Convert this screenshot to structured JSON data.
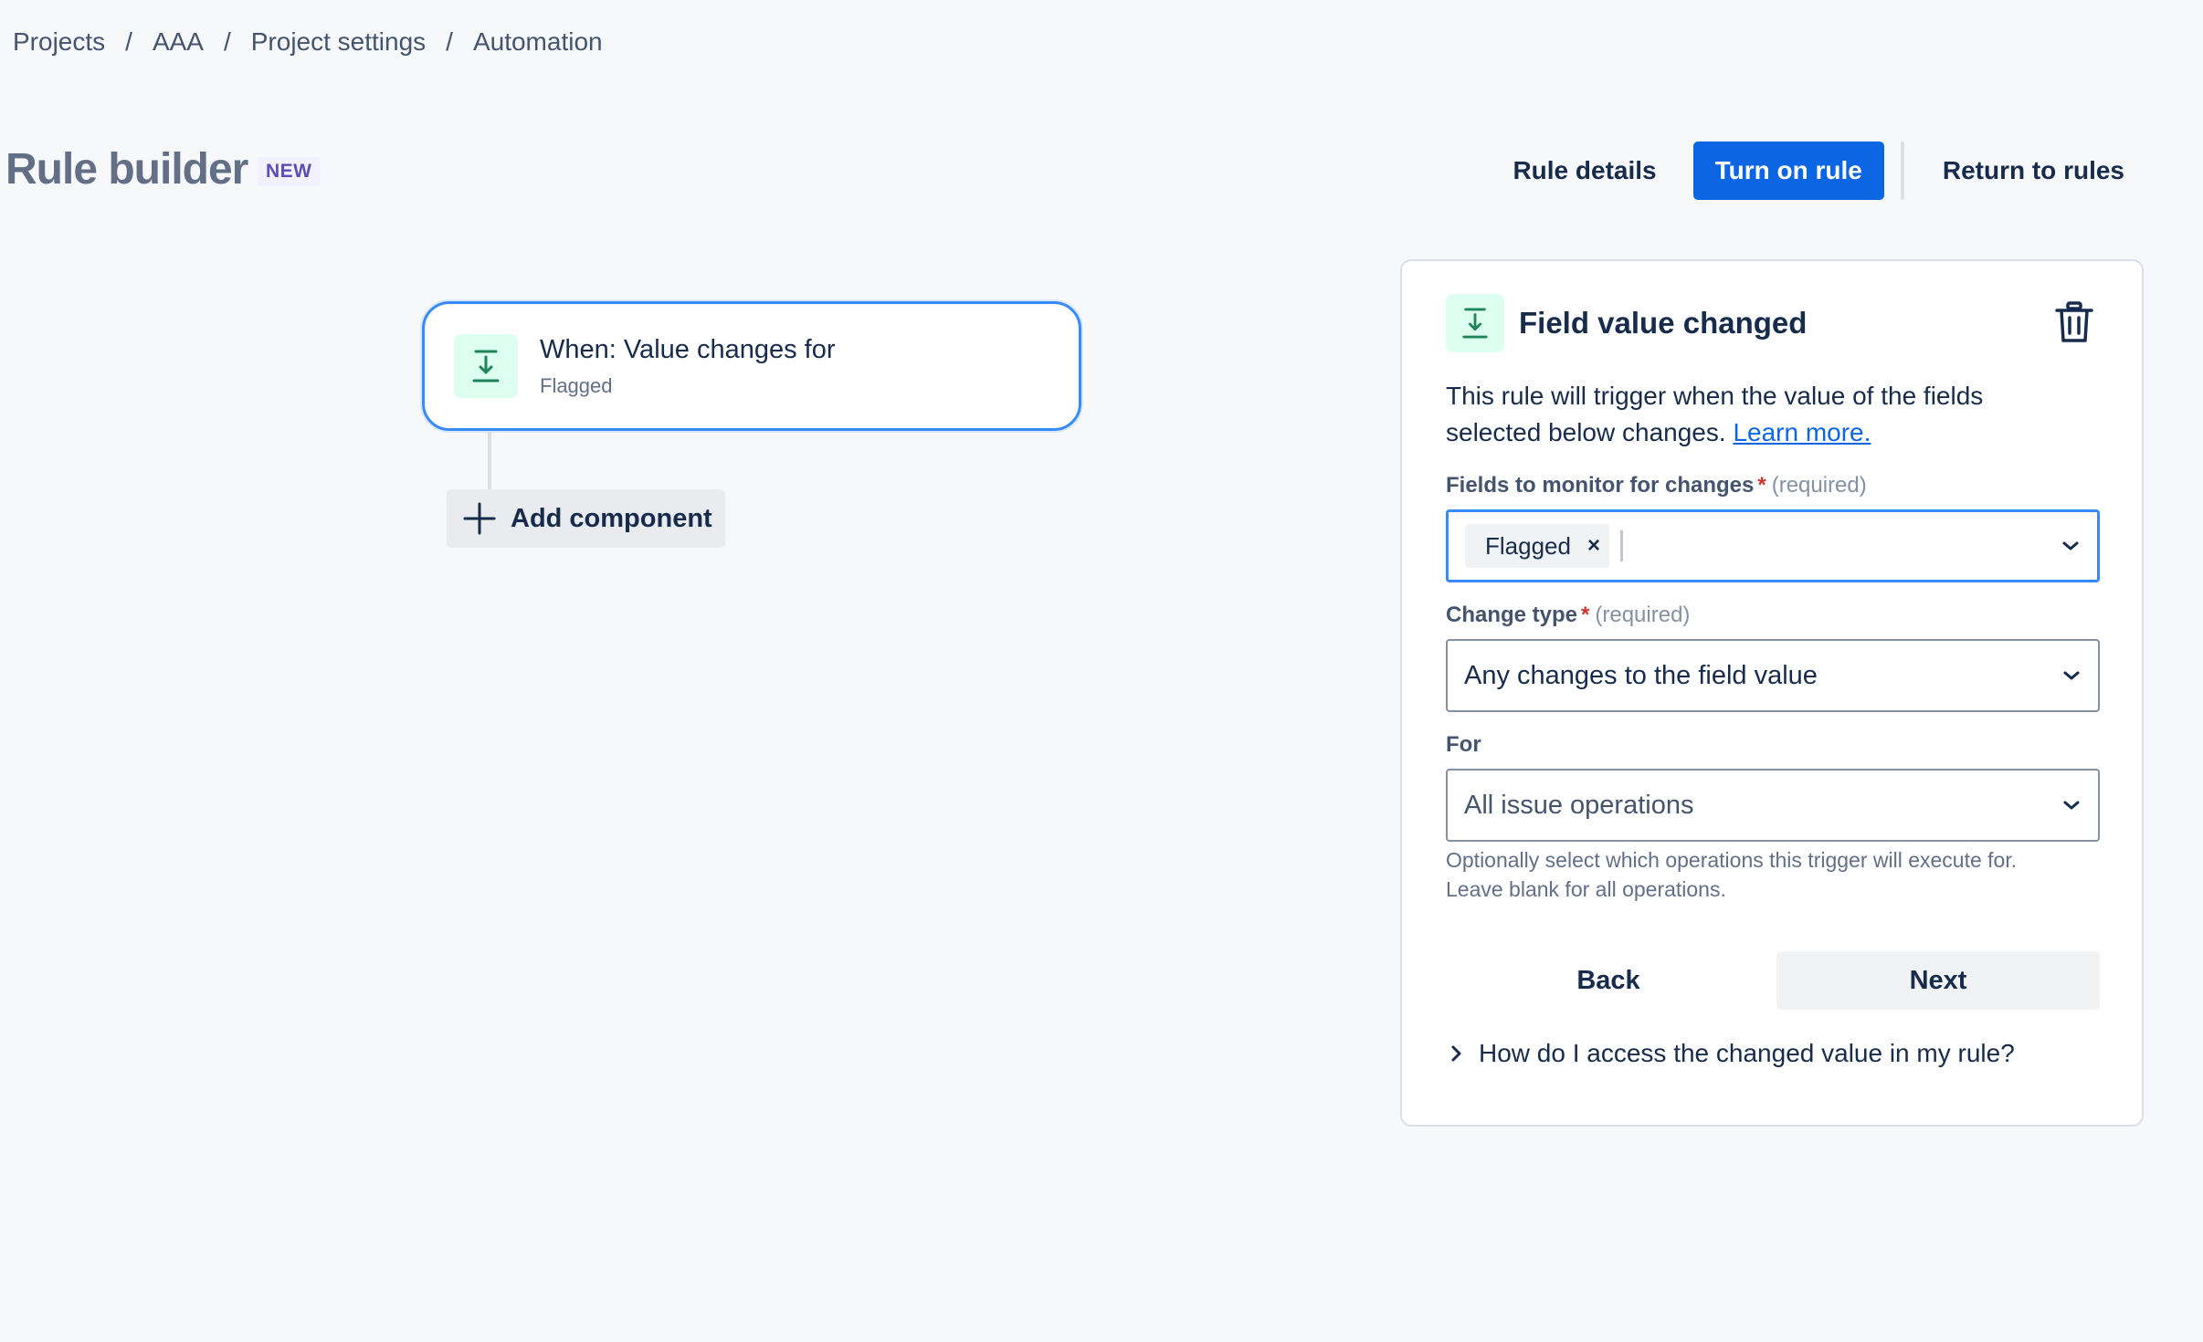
{
  "breadcrumb": {
    "items": [
      "Projects",
      "AAA",
      "Project settings",
      "Automation"
    ],
    "separator": "/"
  },
  "header": {
    "title": "Rule builder",
    "badge": "NEW",
    "rule_details_label": "Rule details",
    "turn_on_label": "Turn on rule",
    "return_label": "Return to rules"
  },
  "canvas": {
    "trigger": {
      "title": "When: Value changes for",
      "subtitle": "Flagged",
      "icon": "download-arrow-icon"
    },
    "add_component_label": "Add component"
  },
  "panel": {
    "title": "Field value changed",
    "description": "This rule will trigger when the value of the fields selected below changes.",
    "learn_more": "Learn more.",
    "fields_monitor": {
      "label": "Fields to monitor for changes",
      "required_mark": "*",
      "required_text": "(required)",
      "tags": [
        "Flagged"
      ],
      "remove_glyph": "×"
    },
    "change_type": {
      "label": "Change type",
      "required_mark": "*",
      "required_text": "(required)",
      "value": "Any changes to the field value"
    },
    "for": {
      "label": "For",
      "value": "All issue operations",
      "helper_line1": "Optionally select which operations this trigger will execute for.",
      "helper_line2": "Leave blank for all operations."
    },
    "back_label": "Back",
    "next_label": "Next",
    "expander_label": "How do I access the changed value in my rule?"
  },
  "colors": {
    "primary": "#0C66E4",
    "focus": "#388BFF",
    "icon_bg": "#DCFFF1",
    "icon_fg": "#1F845A",
    "badge_bg": "#F3F0FF",
    "badge_fg": "#5E4DB2",
    "required": "#C9372C"
  }
}
